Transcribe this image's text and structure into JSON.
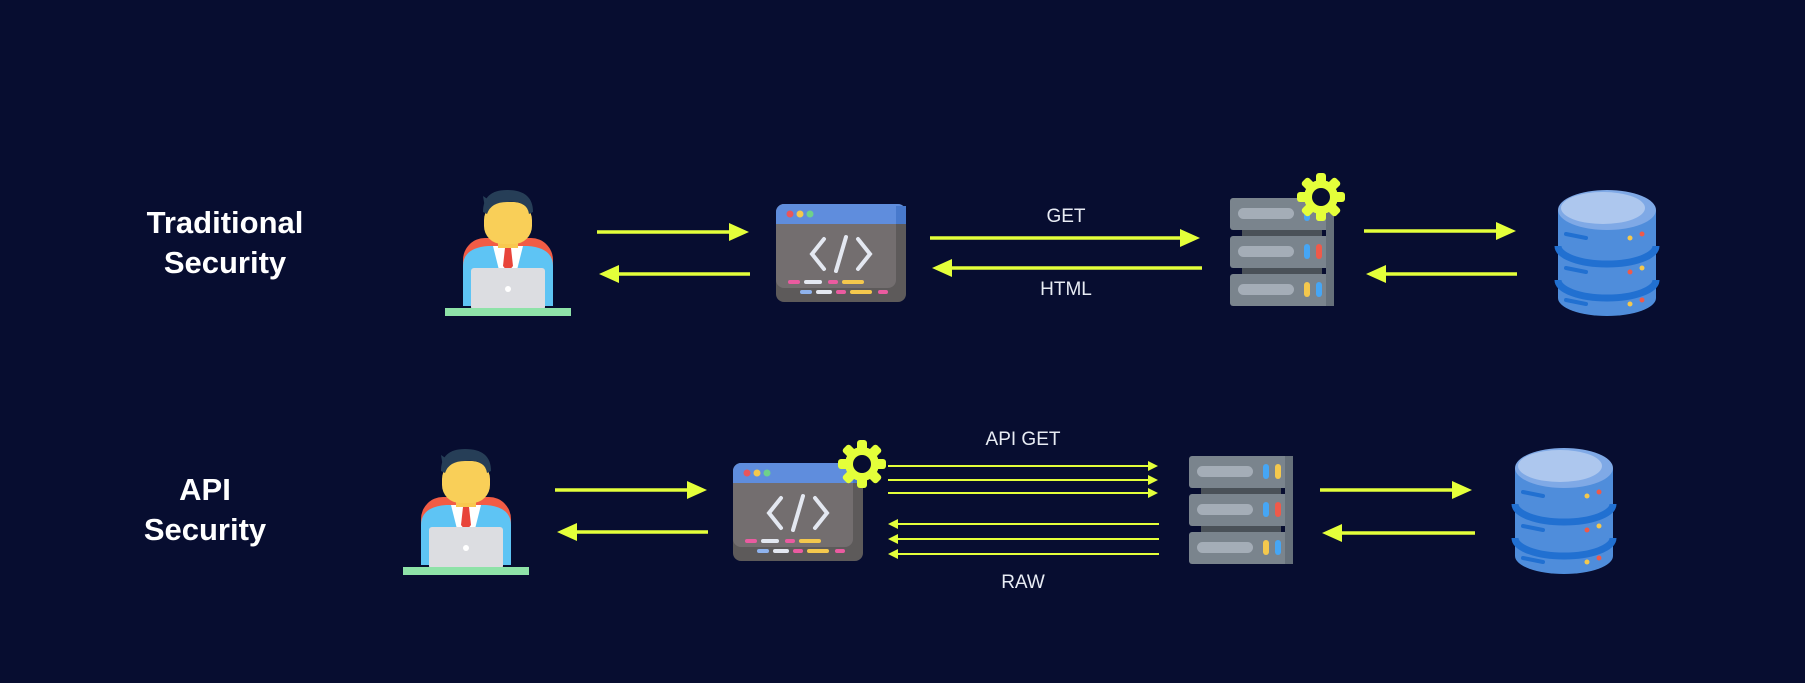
{
  "colors": {
    "background": "#070d30",
    "arrow": "#e4ff3a",
    "text": "#ffffff"
  },
  "rows": [
    {
      "id": "traditional",
      "label_line1": "Traditional",
      "label_line2": "Security",
      "request_label": "GET",
      "response_label": "HTML",
      "nodes": [
        "user-icon",
        "web-app-icon",
        "server-icon",
        "database-icon"
      ],
      "gear_on": "server"
    },
    {
      "id": "api",
      "label_line1": "API",
      "label_line2": "Security",
      "request_label": "API GET",
      "response_label": "RAW",
      "nodes": [
        "user-icon",
        "web-app-icon",
        "server-icon",
        "database-icon"
      ],
      "gear_on": "web-app"
    }
  ]
}
